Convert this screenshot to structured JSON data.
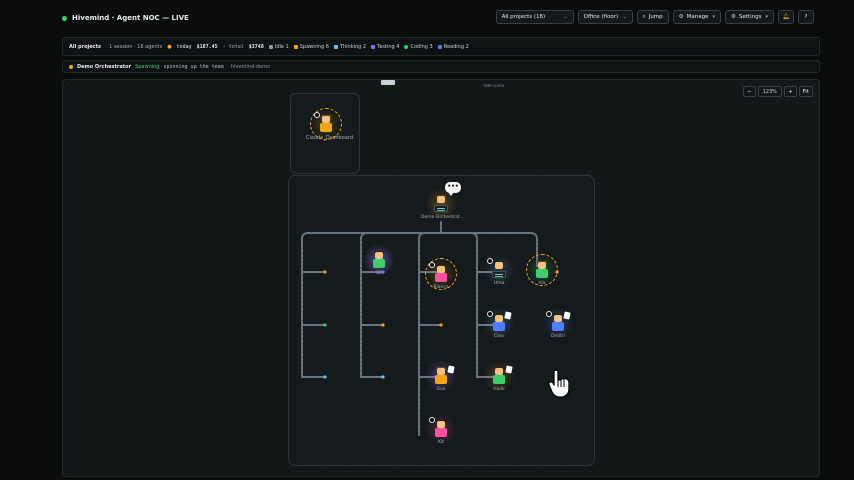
{
  "header": {
    "title": "Hivemind · Agent NOC — LIVE",
    "project_select": "All projects (18)",
    "view_select": "Office (floor)",
    "jump_label": "Jump",
    "manage_label": "Manage",
    "settings_label": "Settings",
    "help_label": "?",
    "live_color": "#3ccf6e"
  },
  "stats": {
    "scope": "All projects",
    "sessions": "· 1 session · 18 agents",
    "today_label": "today",
    "today_value": "$187.45",
    "total_label": "· total",
    "total_value": "$3748",
    "statuses": [
      {
        "label": "Idle 1",
        "color": "#8e979f"
      },
      {
        "label": "Spawning 6",
        "color": "#f2a516"
      },
      {
        "label": "Thinking 2",
        "color": "#6ec2ff"
      },
      {
        "label": "Testing 4",
        "color": "#8a6bff"
      },
      {
        "label": "Coding 3",
        "color": "#3ccf6e"
      },
      {
        "label": "Reading 2",
        "color": "#4f7dff"
      }
    ]
  },
  "orchestrator": {
    "name": "Demo Orchestrator",
    "status": "Spawning",
    "message": "spinning up the team",
    "project": "· hivemind-demo"
  },
  "canvas": {
    "zoom_minus": "−",
    "zoom_value": "123%",
    "zoom_plus": "+",
    "fit_label": "Fit",
    "time_clock_label": "TIME CLOCK",
    "dashboard_room_agent": "Claude_Dashboard",
    "agents": [
      {
        "name": "Demo Orchestrat..."
      },
      {
        "name": "Eli"
      },
      {
        "name": "Bianca"
      },
      {
        "name": "Uma"
      },
      {
        "name": "Ida"
      },
      {
        "name": "Cleo"
      },
      {
        "name": "Dmitri"
      },
      {
        "name": "Gus"
      },
      {
        "name": "Hank"
      },
      {
        "name": "Kit"
      }
    ],
    "bubble_text": "•••"
  }
}
